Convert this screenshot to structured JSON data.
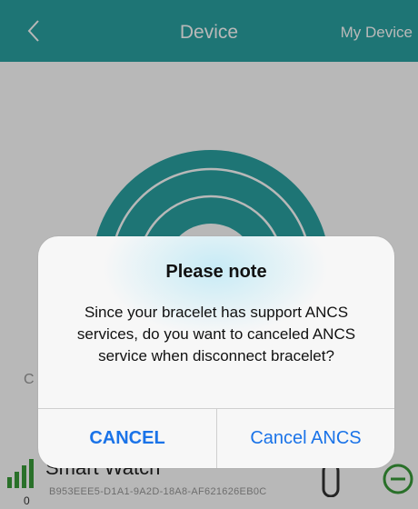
{
  "navbar": {
    "back_icon": "chevron-left-icon",
    "title": "Device",
    "right_label": "My Device",
    "color": "#2aa3a3"
  },
  "background": {
    "section_label_partial": "C",
    "device": {
      "name": "Smart Watch",
      "id": "B953EEE5-D1A1-9A2D-18A8-AF621626EB0C",
      "signal_value": "0",
      "signal_icon": "signal-bars-icon",
      "band_icon": "bracelet-icon",
      "remove_icon": "remove-circle-icon"
    },
    "rings_icon": "wireless-signal-icon",
    "accent": "#2aa3a3"
  },
  "alert": {
    "title": "Please note",
    "message": "Since your bracelet has support ANCS services, do you want to canceled ANCS service when disconnect bracelet?",
    "buttons": {
      "cancel": "CANCEL",
      "cancel_ancs": "Cancel ANCS"
    },
    "button_color": "#1a73e8"
  }
}
